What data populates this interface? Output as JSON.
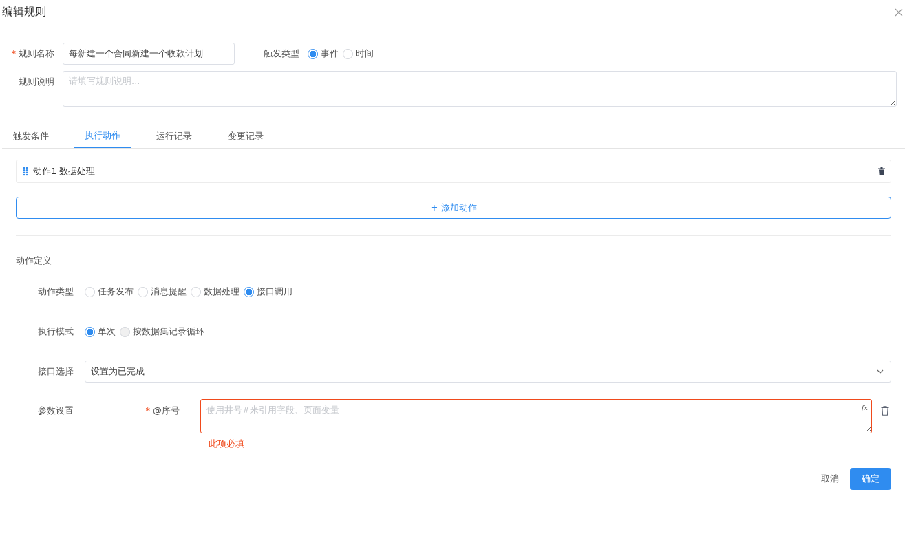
{
  "window": {
    "title": "编辑规则"
  },
  "rule_name": {
    "label": "规则名称",
    "required_mark": "*",
    "value": "每新建一个合同新建一个收款计划"
  },
  "trigger_type": {
    "label": "触发类型",
    "options": [
      {
        "label": "事件",
        "selected": true
      },
      {
        "label": "时间",
        "selected": false
      }
    ]
  },
  "rule_desc": {
    "label": "规则说明",
    "placeholder": "请填写规则说明..."
  },
  "tabs": [
    {
      "label": "触发条件",
      "selected": false
    },
    {
      "label": "执行动作",
      "selected": true
    },
    {
      "label": "运行记录",
      "selected": false
    },
    {
      "label": "变更记录",
      "selected": false
    }
  ],
  "actions": [
    {
      "label": "动作1 数据处理"
    }
  ],
  "add_action": "+ 添加动作",
  "section_title": "动作定义",
  "action_type": {
    "label": "动作类型",
    "options": [
      {
        "label": "任务发布",
        "selected": false
      },
      {
        "label": "消息提醒",
        "selected": false
      },
      {
        "label": "数据处理",
        "selected": false
      },
      {
        "label": "接口调用",
        "selected": true
      }
    ]
  },
  "exec_mode": {
    "label": "执行模式",
    "options": [
      {
        "label": "单次",
        "selected": true,
        "disabled": false
      },
      {
        "label": "按数据集记录循环",
        "selected": false,
        "disabled": true
      }
    ]
  },
  "interface": {
    "label": "接口选择",
    "value": "设置为已完成"
  },
  "params": {
    "label": "参数设置",
    "items": [
      {
        "name": "@序号",
        "required_mark": "*",
        "operator": "=",
        "placeholder": "使用井号#来引用字段、页面变量",
        "fx": "fx",
        "error": "此项必填"
      }
    ]
  },
  "buttons": {
    "cancel": "取消",
    "ok": "确定"
  }
}
